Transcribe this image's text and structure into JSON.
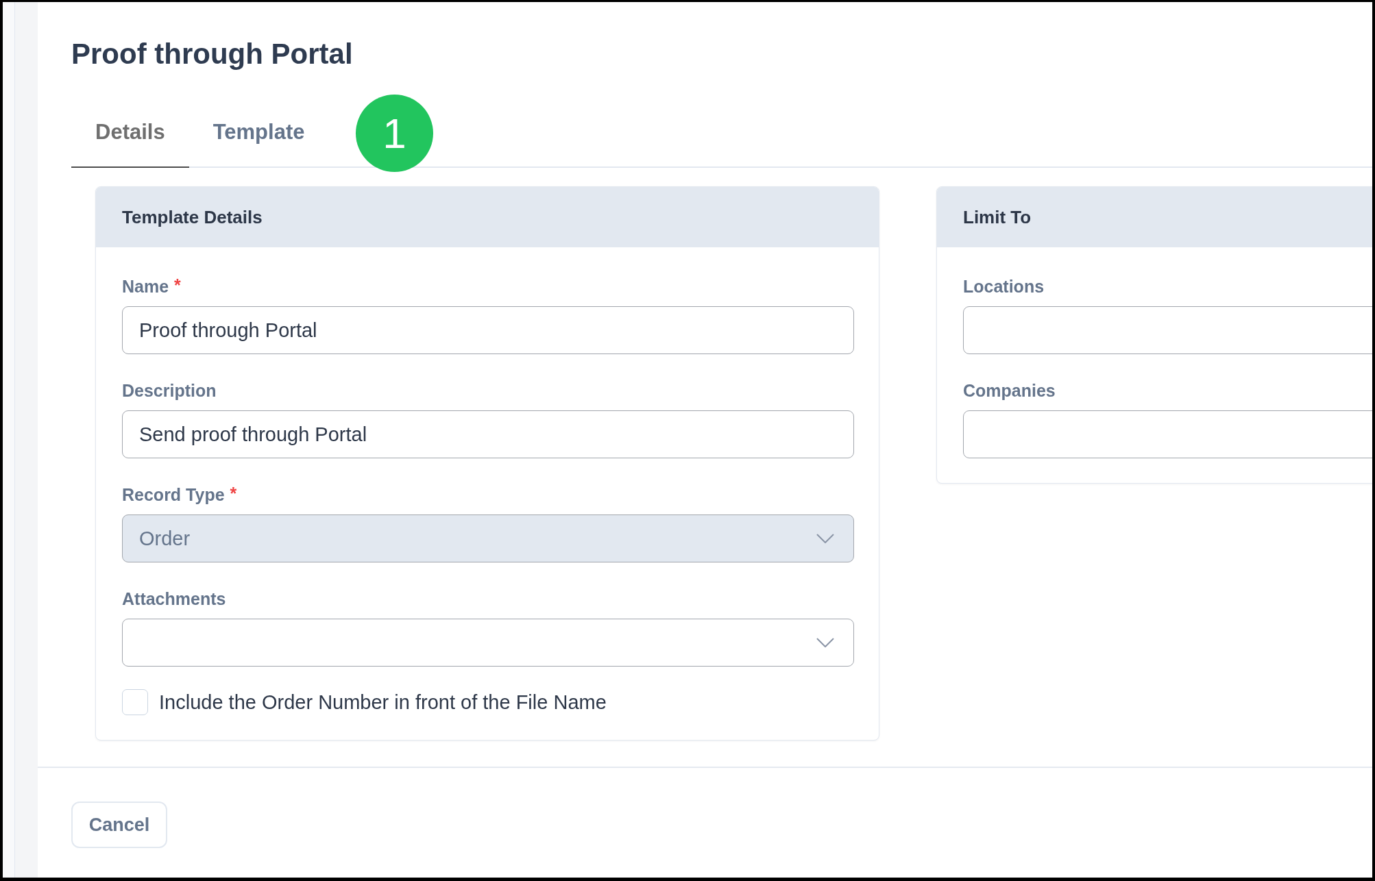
{
  "page": {
    "title": "Proof through Portal"
  },
  "tabs": [
    {
      "label": "Details",
      "selected": true
    },
    {
      "label": "Template",
      "selected": false
    }
  ],
  "callout": {
    "number": "1"
  },
  "template_details": {
    "title": "Template Details",
    "fields": [
      {
        "kind": "text",
        "label": "Name",
        "required_mark": "*",
        "value": "Proof through Portal"
      },
      {
        "kind": "text",
        "label": "Description",
        "value": "Send proof through Portal"
      },
      {
        "kind": "select",
        "label": "Record Type",
        "required_mark": "*",
        "value": "Order",
        "disabled": true
      },
      {
        "kind": "select",
        "label": "Attachments",
        "disabled": false
      },
      {
        "kind": "checkbox",
        "label": "Include the Order Number in front of the File Name",
        "checked": false
      }
    ]
  },
  "limit_to": {
    "title": "Limit To",
    "fields": [
      {
        "label": "Locations"
      },
      {
        "label": "Companies"
      }
    ]
  },
  "buttons": [
    {
      "label": "Cancel"
    }
  ]
}
